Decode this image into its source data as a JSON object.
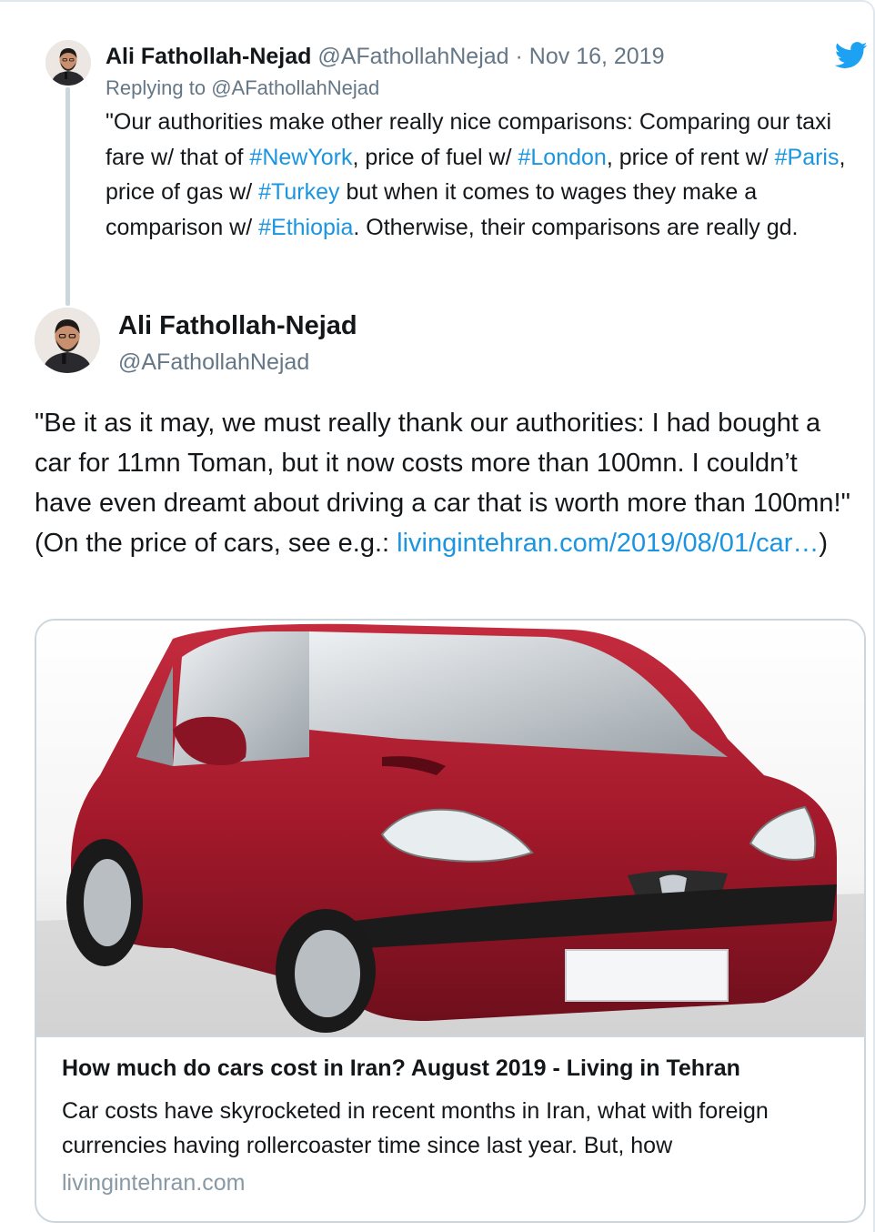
{
  "quoted_tweet": {
    "author_name": "Ali Fathollah-Nejad",
    "author_handle": "@AFathollahNejad",
    "separator": " · ",
    "date": "Nov 16, 2019",
    "replying_prefix": "Replying to ",
    "replying_to": "@AFathollahNejad",
    "text": {
      "t1": "\"Our authorities make other really nice comparisons: Comparing our taxi fare w/ that of ",
      "h1": "#NewYork",
      "t2": ", price of fuel w/ ",
      "h2": "#London",
      "t3": ", price of rent w/ ",
      "h3": "#Paris",
      "t4": ", price of gas w/ ",
      "h4": "#Turkey",
      "t5": " but when it comes to wages they make a comparison w/ ",
      "h5": "#Ethiopia",
      "t6": ". Otherwise, their comparisons are really gd."
    }
  },
  "main_tweet": {
    "author_name": "Ali Fathollah-Nejad",
    "author_handle": "@AFathollahNejad",
    "text_before_link": "\"Be it as it may, we must really thank our authorities: I had bought a car for 11mn Toman, but it now costs more than 100mn. I couldn’t have even dreamt about driving a car that is worth more than 100mn!\" (On the price of cars, see e.g.: ",
    "link": "livingintehran.com/2019/08/01/car…",
    "text_after_link": ")"
  },
  "link_card": {
    "title": "How much do cars cost in Iran? August 2019 - Living in Tehran",
    "description": "Car costs have skyrocketed in recent months in Iran, what with foreign currencies having rollercoaster time since last year. But, how",
    "domain": "livingintehran.com"
  },
  "colors": {
    "link": "#1b95e0",
    "secondary_text": "#657786",
    "car_body": "#a3192b",
    "twitter_blue": "#1da1f2"
  },
  "icons": [
    "twitter-bird-icon",
    "avatar"
  ]
}
